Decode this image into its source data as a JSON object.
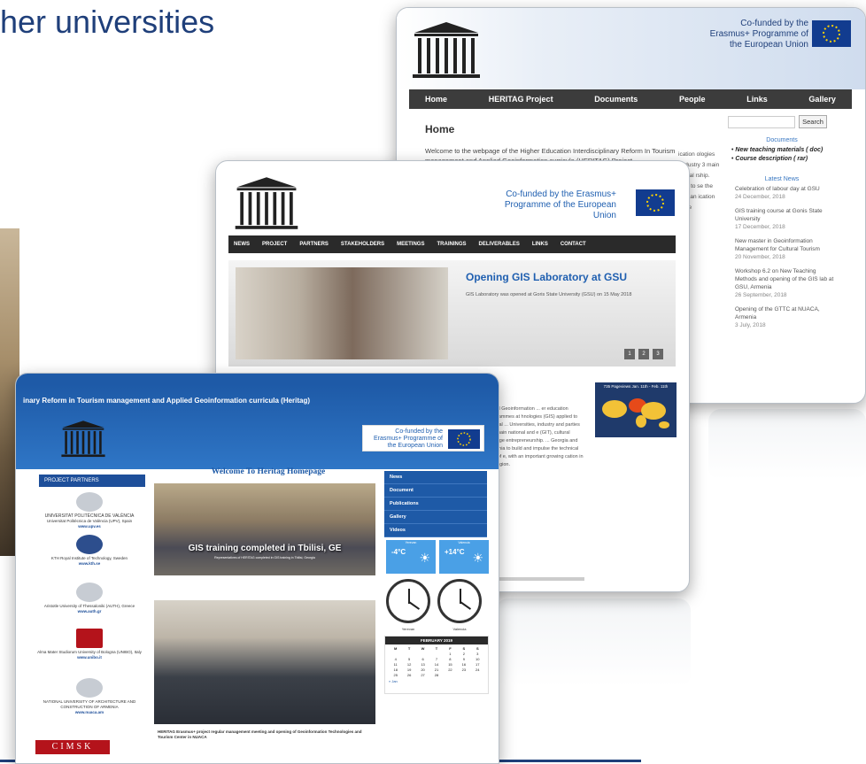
{
  "slide": {
    "title": "her universities"
  },
  "shot1": {
    "cofund": "Co-funded by the Erasmus+ Programme of the European Union",
    "nav": [
      "Home",
      "HERITAG Project",
      "Documents",
      "People",
      "Links",
      "Gallery"
    ],
    "heading": "Home",
    "welcome": "Welcome to the webpage of the Higher Education Interdisciplinary Reform In Tourism management and Applied Geoinformation curricula (HERITAG) Project",
    "search_button": "Search",
    "documents_heading": "Documents",
    "documents": [
      "New teaching materials ( doc)",
      "Course description ( rar)"
    ],
    "latest_heading": "Latest News",
    "news": [
      {
        "title": "Celebration of labour day at GSU",
        "date": "24 December, 2018"
      },
      {
        "title": "GIS training course at Gonis State University",
        "date": "17 December, 2018"
      },
      {
        "title": "New master in Geoinformation Management for Cultural Tourism",
        "date": "20 November, 2018"
      },
      {
        "title": "Workshop 6.2 on New Teaching Methods and opening of the GIS lab at GSU, Armenia",
        "date": "26 September, 2018"
      },
      {
        "title": "Opening of the GTTC at NUACA, Armenia",
        "date": "3 July, 2018"
      }
    ],
    "behind_text": "ication ologies p. dustry 3 main ultural rship. ems to se the with an ication State"
  },
  "shot2": {
    "cofund": "Co-funded by the Erasmus+ Programme of the European Union",
    "nav": [
      "NEWS",
      "PROJECT",
      "PARTNERS",
      "STAKEHOLDERS",
      "MEETINGS",
      "TRAININGS",
      "DELIVERABLES",
      "LINKS",
      "CONTACT"
    ],
    "slide_title": "Opening GIS Laboratory at GSU",
    "slide_sub": "GIS Laboratory was opened at Goris State University (GSU) on 15 May 2018",
    "slide_dots": [
      "1",
      "2",
      "3"
    ],
    "body_text": "pplied Geoinformation ... er education programmes at hnologies (GIS) applied to cultural ... Universities, industry and parties in 3 main national and e (GIT), cultural heritage entrepreneurship. ... Georgia and Armenia to build and impulse the technical field of e, with an important growing cation in the region.",
    "map_caption": "735 Pageviews Jan. 11th - Feb. 11th"
  },
  "shot3": {
    "banner_title": "inary Reform in Tourism management and Applied Geoinformation curricula (Heritag)",
    "cofund": "Co-funded by the Erasmus+ Programme of the European Union",
    "partners_heading": "PROJECT PARTNERS",
    "partners": [
      {
        "name": "UNIVERSITAT POLITÈCNICA DE VALÈNCIA",
        "line": "Universitat Politècnica de València (UPV), Spain",
        "url": "www.upv.es"
      },
      {
        "name": "",
        "line": "KTH Royal Institute of Technology, Sweden",
        "url": "www.kth.se"
      },
      {
        "name": "",
        "line": "Aristotle University of Thessaloniki (AUTH), Greece",
        "url": "www.auth.gr"
      },
      {
        "name": "",
        "line": "Alma Mater Studiorum University of Bologna (UNIBO), Italy",
        "url": "www.unibo.it"
      },
      {
        "name": "",
        "line": "NATIONAL UNIVERSITY OF ARCHITECTURE AND CONSTRUCTION OF ARMENIA",
        "url": "www.nuaca.am"
      }
    ],
    "cimsk": "CIMSK",
    "welcome": "Welcome To Heritag Homepage",
    "photo1_caption": "GIS training completed in Tbilisi, GE",
    "photo1_sub": "Representatives of HERITAG completed in GIS training in Tbilisi, Georgia",
    "photo2_caption": "HERITAG Erasmus+ project regular management meeting and opening of Geoinformation Technologies and Tourism Center in NUACA",
    "menu": [
      "News",
      "Document",
      "Publications",
      "Gallery",
      "Videos"
    ],
    "weather": [
      {
        "loc": "Yerevan",
        "temp": "-4°C"
      },
      {
        "loc": "Valencia",
        "temp": "+14°C"
      }
    ],
    "clocks": [
      "Yerevan",
      "Valencia"
    ],
    "calendar_title": "FEBRUARY 2019",
    "calendar_days": [
      "M",
      "T",
      "W",
      "T",
      "F",
      "S",
      "S"
    ],
    "calendar_dates": [
      "",
      "",
      "",
      "",
      "1",
      "2",
      "3",
      "4",
      "5",
      "6",
      "7",
      "8",
      "9",
      "10",
      "11",
      "12",
      "13",
      "14",
      "15",
      "16",
      "17",
      "18",
      "19",
      "20",
      "21",
      "22",
      "23",
      "24",
      "25",
      "26",
      "27",
      "28",
      "",
      "",
      ""
    ],
    "calendar_link": "« Jan"
  }
}
